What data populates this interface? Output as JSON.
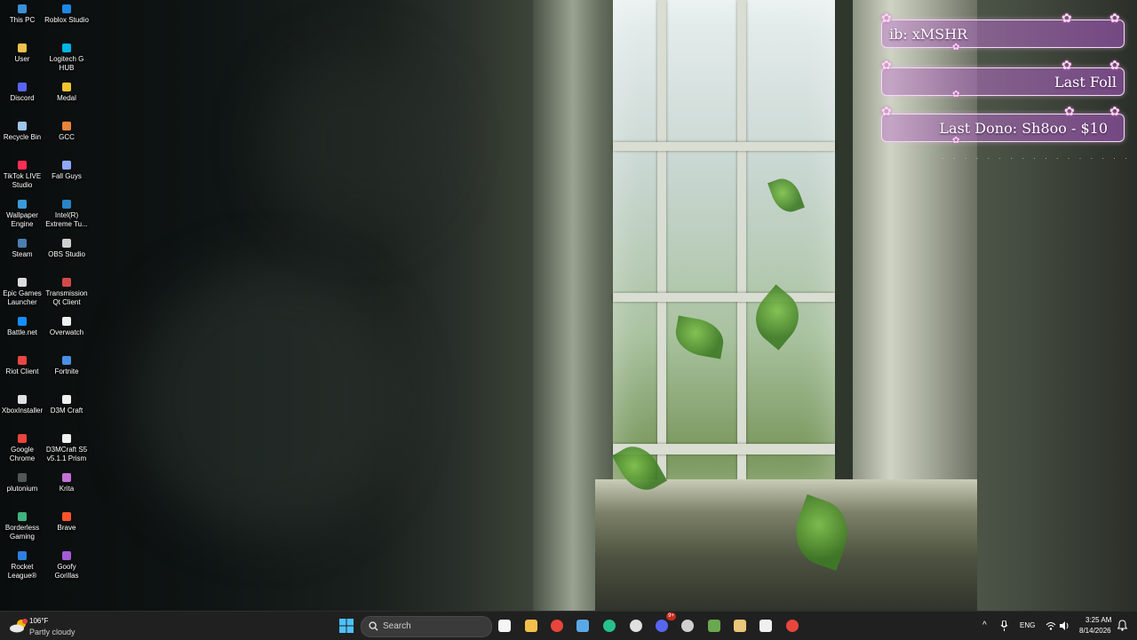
{
  "desktop": {
    "icons": [
      {
        "label": "This PC",
        "icon": "this-pc-icon",
        "color": "#3b8fd6"
      },
      {
        "label": "Roblox Studio",
        "icon": "roblox-studio-icon",
        "color": "#1e88e5"
      },
      {
        "label": "User",
        "icon": "folder-icon",
        "color": "#f3c14b"
      },
      {
        "label": "Logitech G HUB",
        "icon": "logitech-g-hub-icon",
        "color": "#00b4e6"
      },
      {
        "label": "Discord",
        "icon": "discord-icon",
        "color": "#5865f2"
      },
      {
        "label": "Medal",
        "icon": "medal-icon",
        "color": "#f2c230"
      },
      {
        "label": "Recycle Bin",
        "icon": "recycle-bin-icon",
        "color": "#9ec6e8"
      },
      {
        "label": "GCC",
        "icon": "gcc-icon",
        "color": "#e8833a"
      },
      {
        "label": "TikTok LIVE Studio",
        "icon": "tiktok-live-studio-icon",
        "color": "#ff2d55"
      },
      {
        "label": "Fall Guys",
        "icon": "fall-guys-icon",
        "color": "#8fa8ff"
      },
      {
        "label": "Wallpaper Engine",
        "icon": "wallpaper-engine-icon",
        "color": "#3a9ad9"
      },
      {
        "label": "Intel(R) Extreme Tu...",
        "icon": "intel-xtu-icon",
        "color": "#2a84c8"
      },
      {
        "label": "Steam",
        "icon": "steam-icon",
        "color": "#4a7fb0"
      },
      {
        "label": "OBS Studio",
        "icon": "obs-studio-icon",
        "color": "#d0d0d0"
      },
      {
        "label": "Epic Games Launcher",
        "icon": "epic-games-icon",
        "color": "#dcdcdc"
      },
      {
        "label": "Transmission Qt Client",
        "icon": "transmission-icon",
        "color": "#d14a4a"
      },
      {
        "label": "Battle.net",
        "icon": "battle-net-icon",
        "color": "#148eff"
      },
      {
        "label": "Overwatch",
        "icon": "overwatch-icon",
        "color": "#f0f0f0"
      },
      {
        "label": "Riot Client",
        "icon": "riot-client-icon",
        "color": "#e84545"
      },
      {
        "label": "Fortnite",
        "icon": "fortnite-icon",
        "color": "#4a90e2"
      },
      {
        "label": "XboxInstaller",
        "icon": "xbox-icon",
        "color": "#e0e0e0"
      },
      {
        "label": "D3M Craft",
        "icon": "d3m-craft-icon",
        "color": "#f0f0f0"
      },
      {
        "label": "Google Chrome",
        "icon": "google-chrome-icon",
        "color": "#e8453c"
      },
      {
        "label": "D3MCraft S5 v5.1.1 Prism",
        "icon": "d3mcraft-prism-icon",
        "color": "#f0f0f0"
      },
      {
        "label": "plutonium",
        "icon": "plutonium-icon",
        "color": "#555555"
      },
      {
        "label": "Krita",
        "icon": "krita-icon",
        "color": "#c46fd8"
      },
      {
        "label": "Borderless Gaming",
        "icon": "borderless-gaming-icon",
        "color": "#3fb27f"
      },
      {
        "label": "Brave",
        "icon": "brave-icon",
        "color": "#fb542b"
      },
      {
        "label": "Rocket League®",
        "icon": "rocket-league-icon",
        "color": "#2f7fe0"
      },
      {
        "label": "Goofy Gorillas",
        "icon": "goofy-gorillas-icon",
        "color": "#a45cd6"
      }
    ]
  },
  "overlay": {
    "follow_text": "ib: xMSHR",
    "last_follow_text": "Last Foll",
    "last_dono_text": "Last Dono: Sh8oo - $10",
    "dots": "· · · · · · · · · · · · · · · · ·"
  },
  "taskbar": {
    "weather": {
      "temp": "106°F",
      "condition": "Partly cloudy"
    },
    "search_placeholder": "Search",
    "apps": [
      {
        "name": "start-button",
        "icon": "windows-logo-icon",
        "color": "#4cc2ff"
      },
      {
        "name": "microsoft-store-button",
        "icon": "store-icon",
        "color": "#f5f5f5"
      },
      {
        "name": "file-explorer-button",
        "icon": "folder-icon",
        "color": "#f3c14b"
      },
      {
        "name": "chrome-button",
        "icon": "google-chrome-icon",
        "color": "#e8453c"
      },
      {
        "name": "app-window-button",
        "icon": "window-icon",
        "color": "#5aa9e6"
      },
      {
        "name": "edge-button",
        "icon": "edge-icon",
        "color": "#27c18a"
      },
      {
        "name": "settings-button",
        "icon": "gear-icon",
        "color": "#e0e0e0"
      },
      {
        "name": "discord-button",
        "icon": "discord-icon",
        "color": "#5865f2"
      },
      {
        "name": "obs-button",
        "icon": "obs-studio-icon",
        "color": "#d0d0d0"
      },
      {
        "name": "minecraft-button",
        "icon": "minecraft-icon",
        "color": "#6aa84f"
      },
      {
        "name": "cube-app-button",
        "icon": "cube-icon",
        "color": "#e8c67a"
      },
      {
        "name": "mask-app-button",
        "icon": "mask-icon",
        "color": "#f0f0f0"
      },
      {
        "name": "chrome-profile-button",
        "icon": "google-chrome-icon",
        "color": "#e8453c"
      }
    ],
    "discord_badge": "9+",
    "tray": {
      "language": "ENG",
      "time": "3:25 AM",
      "date": "8/14/2026"
    }
  }
}
